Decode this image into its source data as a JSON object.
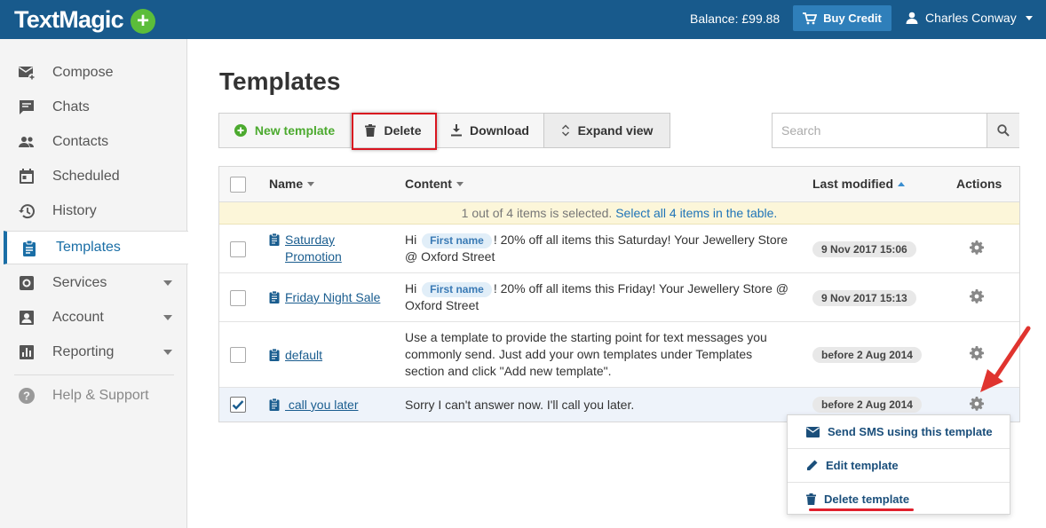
{
  "header": {
    "logo": "TextMagic",
    "logo_plus": "+",
    "balance": "Balance: £99.88",
    "buy_credit": "Buy Credit",
    "user_name": "Charles Conway"
  },
  "sidebar": {
    "items": [
      {
        "label": "Compose",
        "icon": "compose-icon"
      },
      {
        "label": "Chats",
        "icon": "chat-icon"
      },
      {
        "label": "Contacts",
        "icon": "contacts-icon"
      },
      {
        "label": "Scheduled",
        "icon": "calendar-icon"
      },
      {
        "label": "History",
        "icon": "history-icon"
      },
      {
        "label": "Templates",
        "icon": "template-icon",
        "active": true
      },
      {
        "label": "Services",
        "icon": "services-icon"
      },
      {
        "label": "Account",
        "icon": "account-icon"
      },
      {
        "label": "Reporting",
        "icon": "reporting-icon"
      },
      {
        "label": "Help & Support",
        "icon": "help-icon"
      }
    ]
  },
  "page": {
    "title": "Templates"
  },
  "toolbar": {
    "new_template": "New template",
    "delete": "Delete",
    "download": "Download",
    "expand_view": "Expand view"
  },
  "search": {
    "placeholder": "Search"
  },
  "table": {
    "columns": {
      "name": "Name",
      "content": "Content",
      "last_modified": "Last modified",
      "actions": "Actions"
    },
    "selection_banner": {
      "text": "1 out of 4 items is selected.",
      "link": "Select all 4 items in the table."
    },
    "rows": [
      {
        "name_line1": "Saturday",
        "name_line2": "Promotion",
        "content_pre": "Hi",
        "tag": "First name",
        "content_post": "! 20% off all items this Saturday! Your Jewellery Store @ Oxford Street",
        "date": "9 Nov 2017 15:06",
        "checked": false
      },
      {
        "name_line1": "Friday Night Sale",
        "content_pre": "Hi",
        "tag": "First name",
        "content_post": "! 20% off all items this Friday! Your Jewellery Store @ Oxford Street",
        "date": "9 Nov 2017 15:13",
        "checked": false
      },
      {
        "name_line1": "default",
        "content": "Use a template to provide the starting point for text messages you commonly send. Just add your own templates under Templates section and click \"Add new template\".",
        "date": "before 2 Aug 2014",
        "checked": false
      },
      {
        "name_line1": " call you later",
        "content": "Sorry I can't answer now. I'll call you later.",
        "date": "before 2 Aug 2014",
        "checked": true
      }
    ]
  },
  "actions_menu": {
    "send_sms": "Send SMS using this template",
    "edit": "Edit template",
    "delete": "Delete template"
  },
  "colors": {
    "brand": "#185a8c",
    "accent_green": "#5bbd3a",
    "highlight_red": "#d9141f"
  }
}
